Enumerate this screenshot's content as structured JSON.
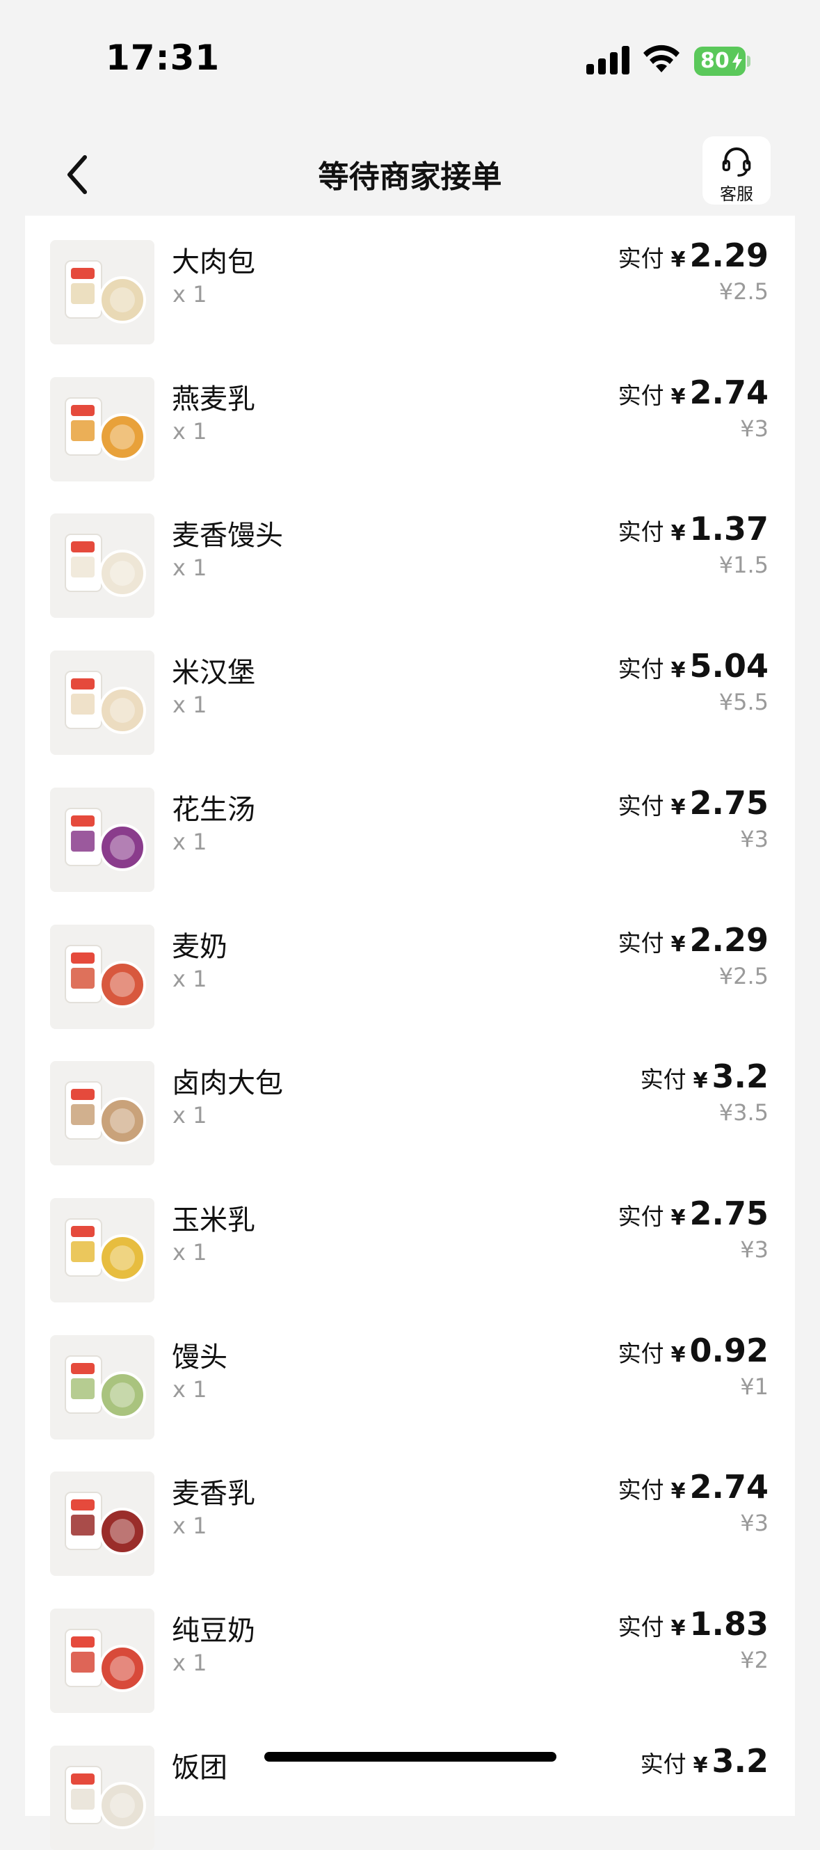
{
  "status_bar": {
    "time": "17:31",
    "battery": "80"
  },
  "nav": {
    "title": "等待商家接单",
    "service_label": "客服"
  },
  "currency": "¥",
  "items": [
    {
      "name": "大肉包",
      "qty": "x 1",
      "paid_label": "实付",
      "paid": "2.29",
      "original": "¥2.5",
      "product_color": "#e9d9b5"
    },
    {
      "name": "燕麦乳",
      "qty": "x 1",
      "paid_label": "实付",
      "paid": "2.74",
      "original": "¥3",
      "product_color": "#e8a13a"
    },
    {
      "name": "麦香馒头",
      "qty": "x 1",
      "paid_label": "实付",
      "paid": "1.37",
      "original": "¥1.5",
      "product_color": "#eee6d6"
    },
    {
      "name": "米汉堡",
      "qty": "x 1",
      "paid_label": "实付",
      "paid": "5.04",
      "original": "¥5.5",
      "product_color": "#ecdcc0"
    },
    {
      "name": "花生汤",
      "qty": "x 1",
      "paid_label": "实付",
      "paid": "2.75",
      "original": "¥3",
      "product_color": "#8a3c8c"
    },
    {
      "name": "麦奶",
      "qty": "x 1",
      "paid_label": "实付",
      "paid": "2.29",
      "original": "¥2.5",
      "product_color": "#d8583e"
    },
    {
      "name": "卤肉大包",
      "qty": "x 1",
      "paid_label": "实付",
      "paid": "3.2",
      "original": "¥3.5",
      "product_color": "#c9a27a"
    },
    {
      "name": "玉米乳",
      "qty": "x 1",
      "paid_label": "实付",
      "paid": "2.75",
      "original": "¥3",
      "product_color": "#e7bd3f"
    },
    {
      "name": "馒头",
      "qty": "x 1",
      "paid_label": "实付",
      "paid": "0.92",
      "original": "¥1",
      "product_color": "#a9c37e"
    },
    {
      "name": "麦香乳",
      "qty": "x 1",
      "paid_label": "实付",
      "paid": "2.74",
      "original": "¥3",
      "product_color": "#9a2d2a"
    },
    {
      "name": "纯豆奶",
      "qty": "x 1",
      "paid_label": "实付",
      "paid": "1.83",
      "original": "¥2",
      "product_color": "#d84a3a"
    },
    {
      "name": "饭团",
      "qty": "",
      "paid_label": "实付",
      "paid": "3.2",
      "original": "",
      "product_color": "#e8e2d6"
    }
  ]
}
